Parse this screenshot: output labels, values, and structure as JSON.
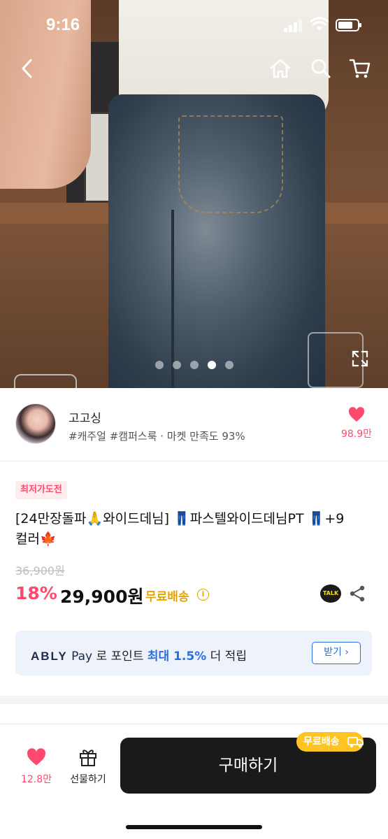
{
  "status_bar": {
    "time": "9:16"
  },
  "gallery": {
    "slides": 5,
    "active_slide": 4
  },
  "seller": {
    "name": "고고싱",
    "tags": "#캐주얼 #캠퍼스룩 · 마켓 만족도 93%",
    "likes": "98.9만"
  },
  "product": {
    "badge": "최저가도전",
    "title_line1": "[24만장돌파🙏와이드데님] 👖파스텔와이드데님PT 👖+9",
    "title_line2": "컬러🍁",
    "original_price": "36,900원",
    "discount": "18%",
    "price": "29,900원",
    "shipping": "무료배송",
    "talk_label": "TALK"
  },
  "ably_pay": {
    "logo": "ABLY",
    "pay": "Pay",
    "text_before": " 로 포인트 ",
    "highlight": "최대 1.5%",
    "text_after": " 더 적립",
    "button": "받기 ›"
  },
  "bottom_bar": {
    "likes": "12.8만",
    "gift_label": "선물하기",
    "buy_label": "구매하기",
    "free_shipping_tag": "무료배송"
  },
  "colors": {
    "accent_pink": "#ff4a6e",
    "shipping_yellow": "#e8a400",
    "ably_blue": "#2a6fe0",
    "buy_button": "#1a1a1a"
  }
}
